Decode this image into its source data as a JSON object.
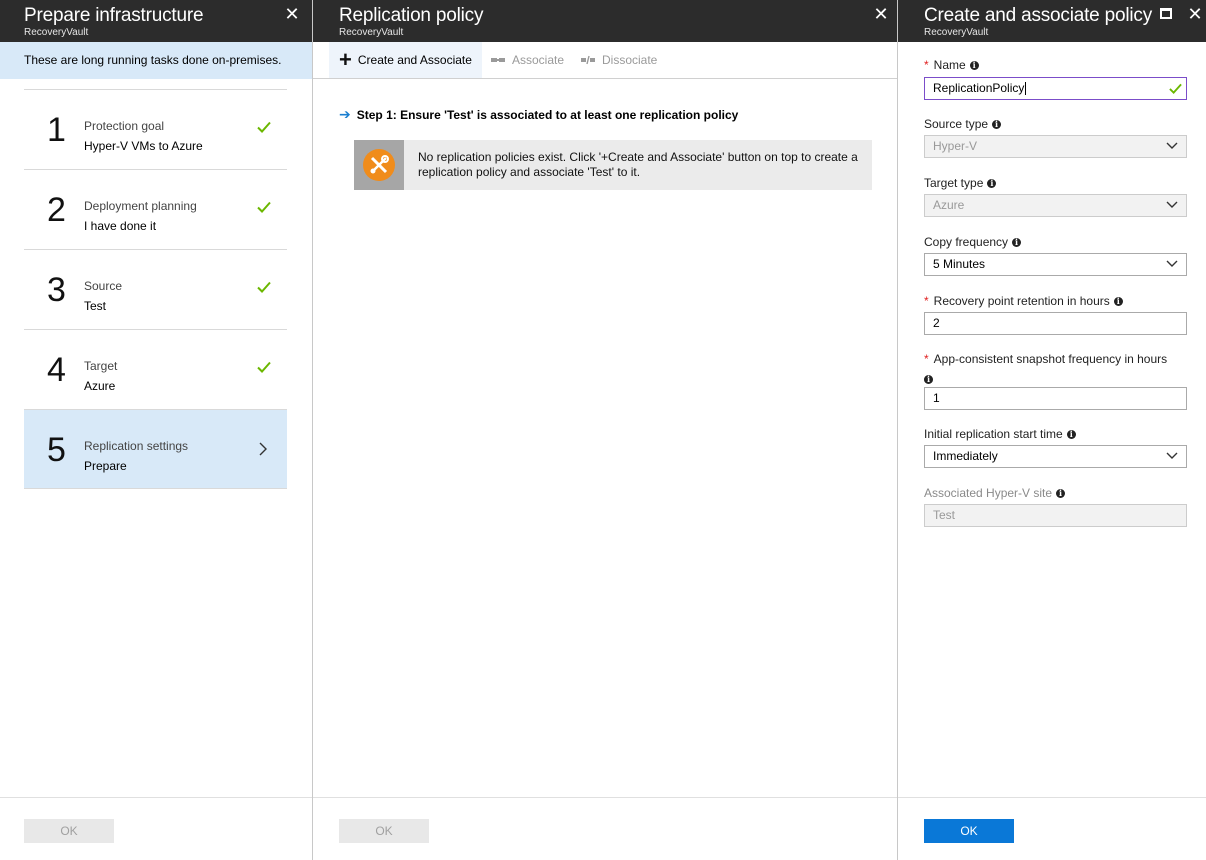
{
  "blade1": {
    "title": "Prepare infrastructure",
    "subtitle": "RecoveryVault",
    "close_icon": "close-icon",
    "info": "These are long running tasks done on-premises.",
    "steps": [
      {
        "number": "1",
        "label": "Protection goal",
        "value": "Hyper-V VMs to Azure",
        "status": "complete"
      },
      {
        "number": "2",
        "label": "Deployment planning",
        "value": "I have done it",
        "status": "complete"
      },
      {
        "number": "3",
        "label": "Source",
        "value": "Test",
        "status": "complete"
      },
      {
        "number": "4",
        "label": "Target",
        "value": "Azure",
        "status": "complete"
      },
      {
        "number": "5",
        "label": "Replication settings",
        "value": "Prepare",
        "status": "active"
      }
    ],
    "ok_label": "OK"
  },
  "blade2": {
    "title": "Replication policy",
    "subtitle": "RecoveryVault",
    "toolbar": {
      "create_associate": "Create and Associate",
      "associate": "Associate",
      "dissociate": "Dissociate"
    },
    "step_heading": "Step 1: Ensure 'Test' is associated to at least one replication policy",
    "notice": "No replication policies exist. Click '+Create and Associate' button on top to create a replication policy and associate 'Test' to it.",
    "ok_label": "OK"
  },
  "blade3": {
    "title": "Create and associate policy",
    "subtitle": "RecoveryVault",
    "fields": {
      "name": {
        "label": "Name",
        "value": "ReplicationPolicy"
      },
      "source_type": {
        "label": "Source type",
        "value": "Hyper-V"
      },
      "target_type": {
        "label": "Target type",
        "value": "Azure"
      },
      "copy_frequency": {
        "label": "Copy frequency",
        "value": "5 Minutes"
      },
      "retention": {
        "label": "Recovery point retention in hours",
        "value": "2"
      },
      "snapshot_freq": {
        "label": "App-consistent snapshot frequency in hours",
        "value": "1"
      },
      "initial_start": {
        "label": "Initial replication start time",
        "value": "Immediately"
      },
      "hyperv_site": {
        "label": "Associated Hyper-V site",
        "value": "Test"
      }
    },
    "ok_label": "OK"
  },
  "colors": {
    "header_bg": "#2c2c2c",
    "info_bg": "#d8e9f8",
    "check": "#6bb700",
    "primary": "#0a78d7",
    "notice_icon": "#f08c1b",
    "required": "#e02020"
  }
}
